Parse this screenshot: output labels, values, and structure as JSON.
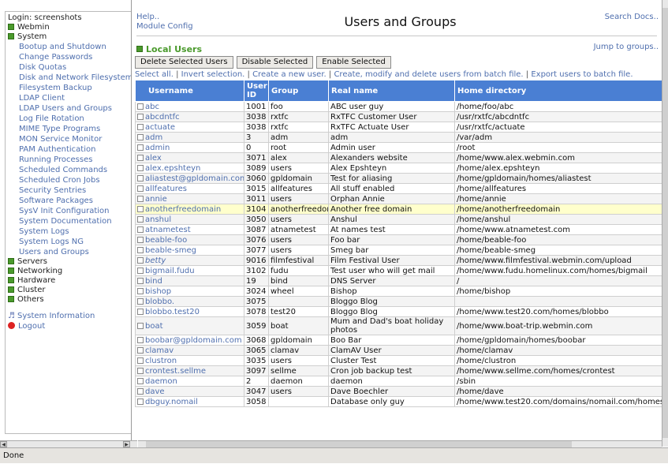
{
  "sidebar": {
    "login": "Login: screenshots",
    "categories": {
      "webmin": "Webmin",
      "system": "System",
      "servers": "Servers",
      "networking": "Networking",
      "hardware": "Hardware",
      "cluster": "Cluster",
      "others": "Others"
    },
    "system_modules": [
      "Bootup and Shutdown",
      "Change Passwords",
      "Disk Quotas",
      "Disk and Network Filesystem",
      "Filesystem Backup",
      "LDAP Client",
      "LDAP Users and Groups",
      "Log File Rotation",
      "MIME Type Programs",
      "MON Service Monitor",
      "PAM Authentication",
      "Running Processes",
      "Scheduled Commands",
      "Scheduled Cron Jobs",
      "Security Sentries",
      "Software Packages",
      "SysV Init Configuration",
      "System Documentation",
      "System Logs",
      "System Logs NG",
      "Users and Groups"
    ],
    "system_information": "System Information",
    "logout": "Logout"
  },
  "header": {
    "help": "Help..",
    "module_config": "Module Config",
    "title": "Users and Groups",
    "search_docs": "Search Docs.."
  },
  "section": {
    "title": "Local Users",
    "jump": "Jump to groups.."
  },
  "buttons": {
    "delete": "Delete Selected Users",
    "disable": "Disable Selected",
    "enable": "Enable Selected"
  },
  "links": {
    "select_all": "Select all.",
    "invert": "Invert selection.",
    "create": "Create a new user.",
    "batch": "Create, modify and delete users from batch file.",
    "export": "Export users to batch file."
  },
  "table": {
    "headers": [
      "Username",
      "User ID",
      "Group",
      "Real name",
      "Home directory"
    ],
    "rows": [
      [
        "abc",
        "1001",
        "foo",
        "ABC user guy",
        "/home/foo/abc"
      ],
      [
        "abcdntfc",
        "3038",
        "rxtfc",
        "RxTFC Customer User",
        "/usr/rxtfc/abcdntfc"
      ],
      [
        "actuate",
        "3038",
        "rxtfc",
        "RxTFC Actuate User",
        "/usr/rxtfc/actuate"
      ],
      [
        "adm",
        "3",
        "adm",
        "adm",
        "/var/adm"
      ],
      [
        "admin",
        "0",
        "root",
        "Admin user",
        "/root"
      ],
      [
        "alex",
        "3071",
        "alex",
        "Alexanders website",
        "/home/www.alex.webmin.com"
      ],
      [
        "alex.epshteyn",
        "3089",
        "users",
        "Alex Epshteyn",
        "/home/alex.epshteyn"
      ],
      [
        "aliastest@gpldomain.com",
        "3060",
        "gpldomain",
        "Test for aliasing",
        "/home/gpldomain/homes/aliastest"
      ],
      [
        "allfeatures",
        "3015",
        "allfeatures",
        "All stuff enabled",
        "/home/allfeatures"
      ],
      [
        "annie",
        "3011",
        "users",
        "Orphan Annie",
        "/home/annie"
      ],
      [
        "anotherfreedomain",
        "3104",
        "anotherfreedomain",
        "Another free domain",
        "/home/anotherfreedomain"
      ],
      [
        "anshul",
        "3050",
        "users",
        "Anshul",
        "/home/anshul"
      ],
      [
        "atnametest",
        "3087",
        "atnametest",
        "At names test",
        "/home/www.atnametest.com"
      ],
      [
        "beable-foo",
        "3076",
        "users",
        "Foo bar",
        "/home/beable-foo"
      ],
      [
        "beable-smeg",
        "3077",
        "users",
        "Smeg bar",
        "/home/beable-smeg"
      ],
      [
        "betty",
        "9016",
        "filmfestival",
        "Film Festival User",
        "/home/www.filmfestival.webmin.com/upload"
      ],
      [
        "bigmail.fudu",
        "3102",
        "fudu",
        "Test user who will get mail",
        "/home/www.fudu.homelinux.com/homes/bigmail"
      ],
      [
        "bind",
        "19",
        "bind",
        "DNS Server",
        "/"
      ],
      [
        "bishop",
        "3024",
        "wheel",
        "Bishop",
        "/home/bishop"
      ],
      [
        "blobbo.",
        "3075",
        "",
        "Bloggo Blog",
        ""
      ],
      [
        "blobbo.test20",
        "3078",
        "test20",
        "Bloggo Blog",
        "/home/www.test20.com/homes/blobbo"
      ],
      [
        "boat",
        "3059",
        "boat",
        "Mum and Dad's boat holiday photos",
        "/home/www.boat-trip.webmin.com"
      ],
      [
        "boobar@gpldomain.com",
        "3068",
        "gpldomain",
        "Boo Bar",
        "/home/gpldomain/homes/boobar"
      ],
      [
        "clamav",
        "3065",
        "clamav",
        "ClamAV User",
        "/home/clamav"
      ],
      [
        "clustron",
        "3035",
        "users",
        "Cluster Test",
        "/home/clustron"
      ],
      [
        "crontest.sellme",
        "3097",
        "sellme",
        "Cron job backup test",
        "/home/www.sellme.com/homes/crontest"
      ],
      [
        "daemon",
        "2",
        "daemon",
        "daemon",
        "/sbin"
      ],
      [
        "dave",
        "3047",
        "users",
        "Dave Boechler",
        "/home/dave"
      ],
      [
        "dbguy.nomail",
        "3058",
        "",
        "Database only guy",
        "/home/www.test20.com/domains/nomail.com/homes/dbguy"
      ]
    ],
    "highlight_row": 10,
    "italic_row": 15,
    "tall_row": 21
  },
  "status": {
    "text": "Done"
  },
  "colors": {
    "header_bg": "#4a7fd3",
    "link": "#4f6fae",
    "highlight": "#ffffcc",
    "category_green": "#4a9a2c"
  }
}
